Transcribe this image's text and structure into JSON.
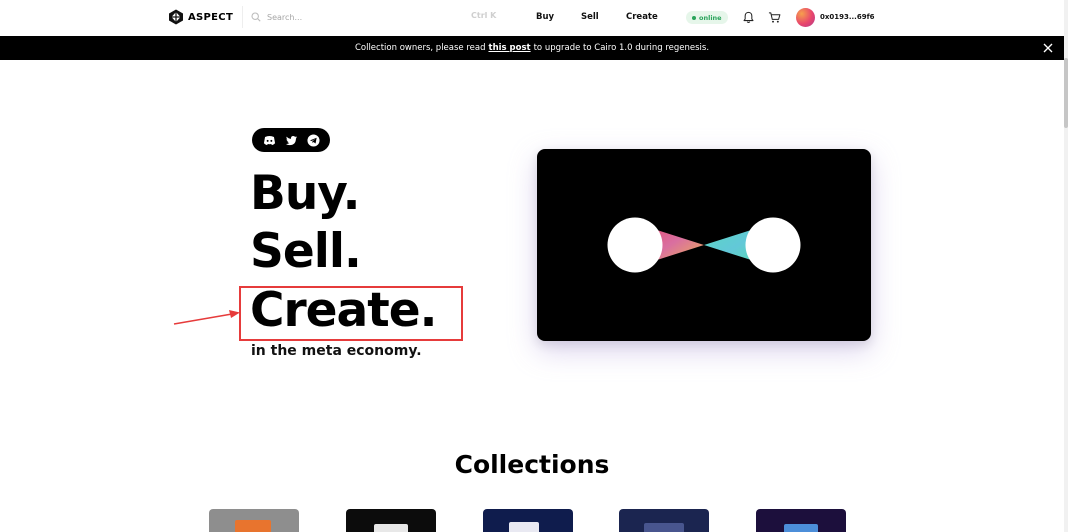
{
  "brand": {
    "name": "ASPECT"
  },
  "nav": {
    "search_placeholder": "Search...",
    "shortcut": "Ctrl K",
    "links": [
      "Buy",
      "Sell",
      "Create"
    ],
    "status": "online",
    "wallet": "0x0193...69f6"
  },
  "banner": {
    "text_before": "Collection owners, please read",
    "link": "this post",
    "text_after": "to upgrade to Cairo 1.0 during regenesis."
  },
  "hero": {
    "lines": [
      "Buy.",
      "Sell.",
      "Create."
    ],
    "subtitle": "in the meta economy."
  },
  "social_icons": [
    "discord-icon",
    "twitter-icon",
    "telegram-icon"
  ],
  "collections": {
    "title": "Collections",
    "thumbnails": [
      {
        "bg": "#8e8e8e",
        "accent": "#e8742e"
      },
      {
        "bg": "#0c0c0c",
        "accent": "#e8e8e8"
      },
      {
        "bg": "#0f1c4d",
        "accent": "#e9e9f2"
      },
      {
        "bg": "#1b2550",
        "accent": "#48558e"
      },
      {
        "bg": "#1c0f3c",
        "accent": "#4c8ed9"
      }
    ]
  },
  "colors": {
    "accent": "#000000",
    "highlight": "#e63b3b",
    "status_green": "#29a35a"
  }
}
